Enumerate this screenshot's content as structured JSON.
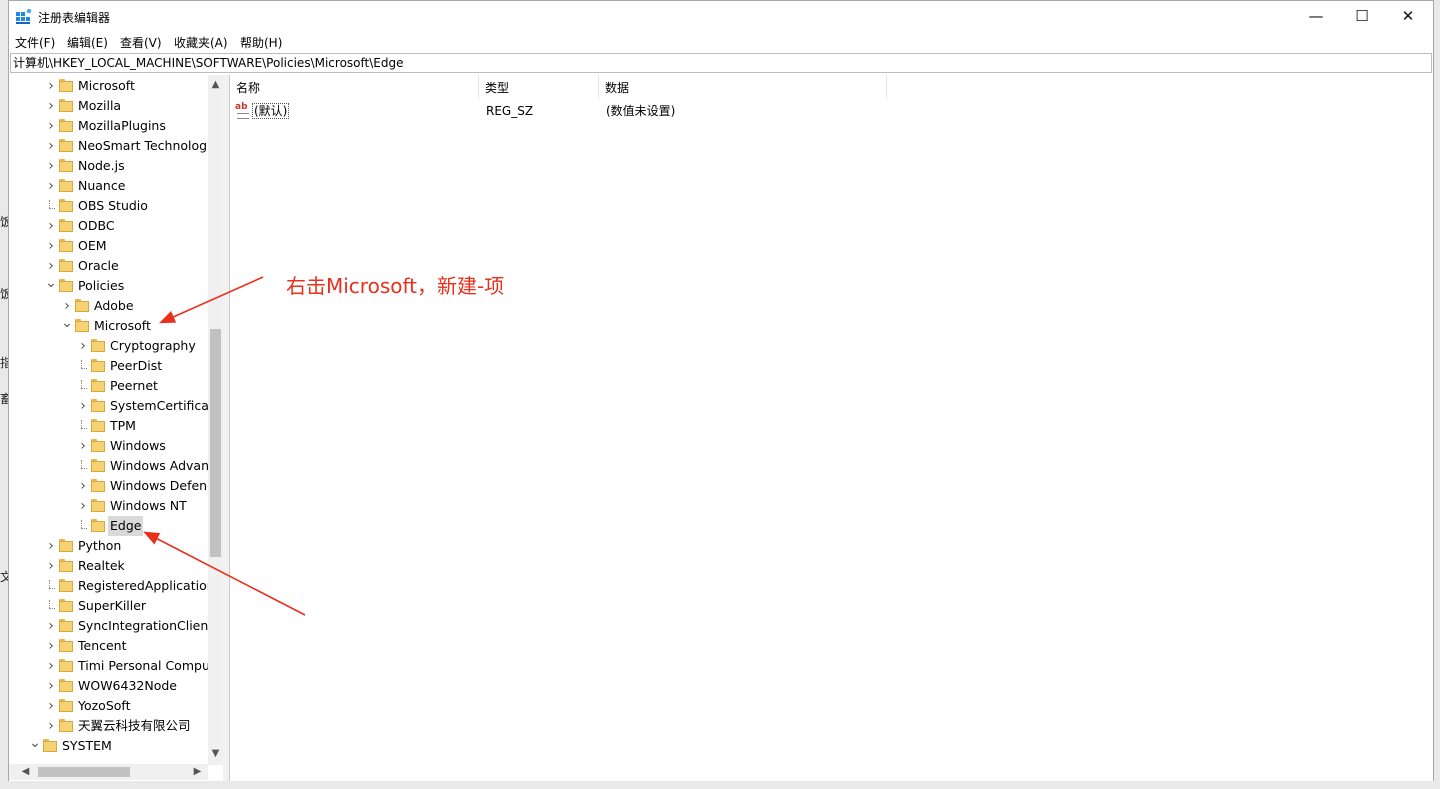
{
  "window": {
    "title": "注册表编辑器",
    "app_icon": "registry-editor-icon",
    "controls": {
      "minimize": "—",
      "maximize": "☐",
      "close": "✕"
    }
  },
  "menu": [
    "文件(F)",
    "编辑(E)",
    "查看(V)",
    "收藏夹(A)",
    "帮助(H)"
  ],
  "address": "计算机\\HKEY_LOCAL_MACHINE\\SOFTWARE\\Policies\\Microsoft\\Edge",
  "background_stubs": [
    "饭",
    "饭",
    "指",
    "畜",
    "文"
  ],
  "tree": [
    {
      "label": "Microsoft",
      "level": 0,
      "arrow": "collapsed"
    },
    {
      "label": "Mozilla",
      "level": 0,
      "arrow": "collapsed"
    },
    {
      "label": "MozillaPlugins",
      "level": 0,
      "arrow": "collapsed"
    },
    {
      "label": "NeoSmart Technologi",
      "level": 0,
      "arrow": "collapsed"
    },
    {
      "label": "Node.js",
      "level": 0,
      "arrow": "collapsed"
    },
    {
      "label": "Nuance",
      "level": 0,
      "arrow": "collapsed"
    },
    {
      "label": "OBS Studio",
      "level": 0,
      "arrow": "none"
    },
    {
      "label": "ODBC",
      "level": 0,
      "arrow": "collapsed"
    },
    {
      "label": "OEM",
      "level": 0,
      "arrow": "collapsed"
    },
    {
      "label": "Oracle",
      "level": 0,
      "arrow": "collapsed"
    },
    {
      "label": "Policies",
      "level": 0,
      "arrow": "expanded"
    },
    {
      "label": "Adobe",
      "level": 1,
      "arrow": "collapsed"
    },
    {
      "label": "Microsoft",
      "level": 1,
      "arrow": "expanded"
    },
    {
      "label": "Cryptography",
      "level": 2,
      "arrow": "collapsed"
    },
    {
      "label": "PeerDist",
      "level": 2,
      "arrow": "none"
    },
    {
      "label": "Peernet",
      "level": 2,
      "arrow": "none"
    },
    {
      "label": "SystemCertificate",
      "level": 2,
      "arrow": "collapsed"
    },
    {
      "label": "TPM",
      "level": 2,
      "arrow": "none"
    },
    {
      "label": "Windows",
      "level": 2,
      "arrow": "collapsed"
    },
    {
      "label": "Windows Advanc",
      "level": 2,
      "arrow": "none"
    },
    {
      "label": "Windows Defenc",
      "level": 2,
      "arrow": "collapsed"
    },
    {
      "label": "Windows NT",
      "level": 2,
      "arrow": "collapsed"
    },
    {
      "label": "Edge",
      "level": 2,
      "arrow": "none",
      "selected": true
    },
    {
      "label": "Python",
      "level": 0,
      "arrow": "collapsed"
    },
    {
      "label": "Realtek",
      "level": 0,
      "arrow": "collapsed"
    },
    {
      "label": "RegisteredApplication",
      "level": 0,
      "arrow": "none"
    },
    {
      "label": "SuperKiller",
      "level": 0,
      "arrow": "none"
    },
    {
      "label": "SyncIntegrationClients",
      "level": 0,
      "arrow": "collapsed"
    },
    {
      "label": "Tencent",
      "level": 0,
      "arrow": "collapsed"
    },
    {
      "label": "Timi Personal Comput",
      "level": 0,
      "arrow": "collapsed"
    },
    {
      "label": "WOW6432Node",
      "level": 0,
      "arrow": "collapsed"
    },
    {
      "label": "YozoSoft",
      "level": 0,
      "arrow": "collapsed"
    },
    {
      "label": "天翼云科技有限公司",
      "level": 0,
      "arrow": "collapsed"
    },
    {
      "label": "SYSTEM",
      "level": -1,
      "arrow": "expanded"
    }
  ],
  "list": {
    "columns": [
      "名称",
      "类型",
      "数据"
    ],
    "rows": [
      {
        "name": "(默认)",
        "type": "REG_SZ",
        "data": "(数值未设置)",
        "icon": "string-value-icon"
      }
    ]
  },
  "annotation": {
    "text": "右击Microsoft，新建-项",
    "color": "#e8301d"
  }
}
